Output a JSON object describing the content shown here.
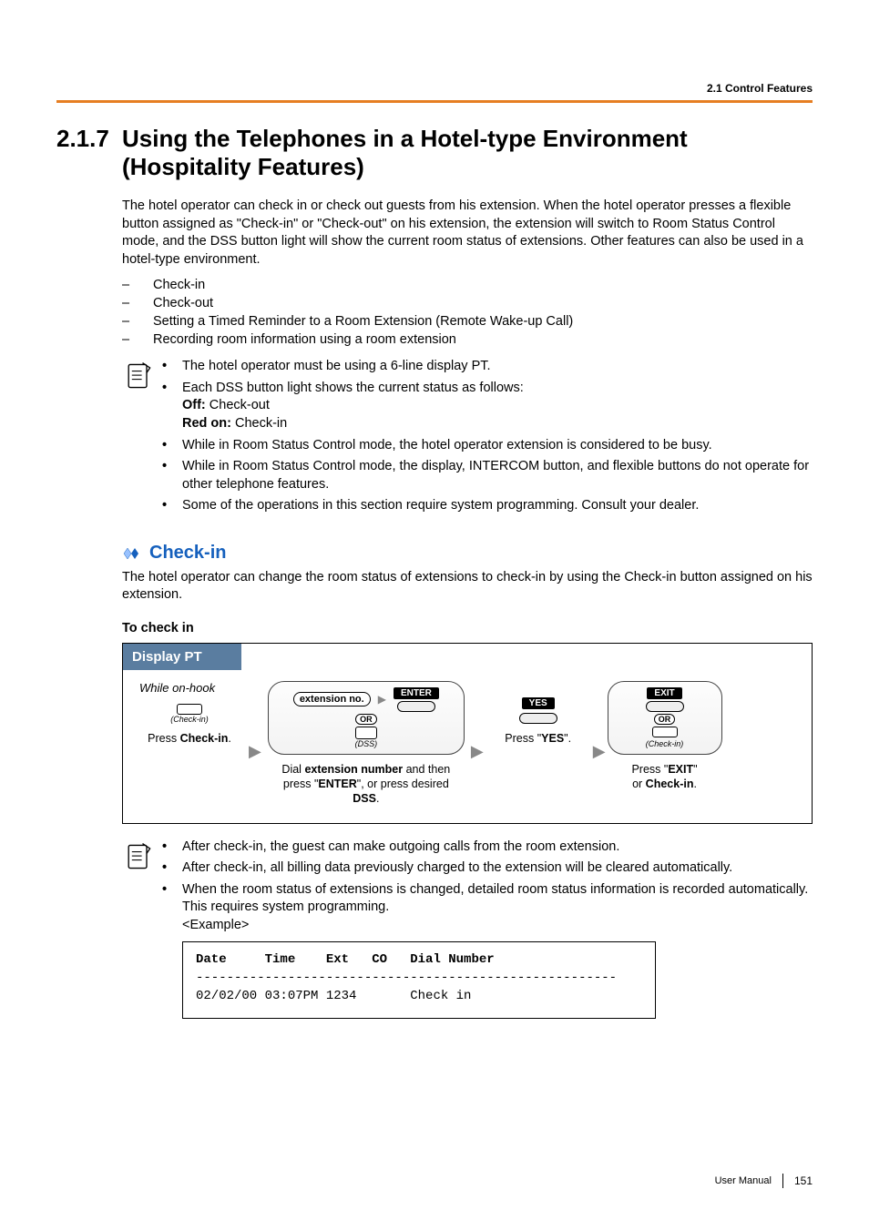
{
  "header": {
    "breadcrumb": "2.1 Control Features"
  },
  "section": {
    "number": "2.1.7",
    "title": "Using the Telephones in a Hotel-type Environment (Hospitality Features)"
  },
  "intro": "The hotel operator can check in or check out guests from his extension. When the hotel operator presses a flexible button assigned as \"Check-in\" or \"Check-out\" on his extension, the extension will switch to Room Status Control mode, and the DSS button light will show the current room status of extensions. Other features can also be used in a hotel-type environment.",
  "featureList": [
    "Check-in",
    "Check-out",
    "Setting a Timed Reminder to a Room Extension (Remote Wake-up Call)",
    "Recording room information using a room extension"
  ],
  "notesA": {
    "line1": "The hotel operator must be using a 6-line display PT.",
    "line2_lead": "Each DSS button light shows the current status as follows:",
    "offLabel": "Off:",
    "offVal": " Check-out",
    "redLabel": "Red on:",
    "redVal": " Check-in",
    "line3": "While in Room Status Control mode, the hotel operator extension is considered to be busy.",
    "line4": "While in Room Status Control mode, the display, INTERCOM button, and flexible buttons do not operate for other telephone features.",
    "line5": "Some of the operations in this section require system programming. Consult your dealer."
  },
  "checkin": {
    "heading": "Check-in",
    "desc": "The hotel operator can change the room status of extensions to check-in by using the Check-in button assigned on his extension.",
    "howTo": "To check in",
    "diagTitle": "Display PT",
    "onhook": "While on-hook",
    "step1_sub": "(Check-in)",
    "step1_cap_a": "Press ",
    "step1_cap_b": "Check-in",
    "step1_cap_c": ".",
    "extNo": "extension no.",
    "enter": "ENTER",
    "or": "OR",
    "dss": "(DSS)",
    "step2_cap": "Dial extension number and then press \"ENTER\", or press desired DSS.",
    "yes": "YES",
    "step3_cap": "Press \"YES\".",
    "exit": "EXIT",
    "step4_sub": "(Check-in)",
    "step4_cap": "Press \"EXIT\" or Check-in."
  },
  "notesB": {
    "n1": "After check-in, the guest can make outgoing calls from the room extension.",
    "n2": "After check-in, all billing data previously charged to the extension will be cleared automatically.",
    "n3a": "When the room status of extensions is changed, detailed room status information is recorded automatically. This requires system programming.",
    "n3b": "<Example>"
  },
  "example": {
    "header": "Date     Time    Ext   CO   Dial Number",
    "row": "02/02/00 03:07PM 1234       Check in"
  },
  "footer": {
    "manual": "User Manual",
    "page": "151"
  }
}
